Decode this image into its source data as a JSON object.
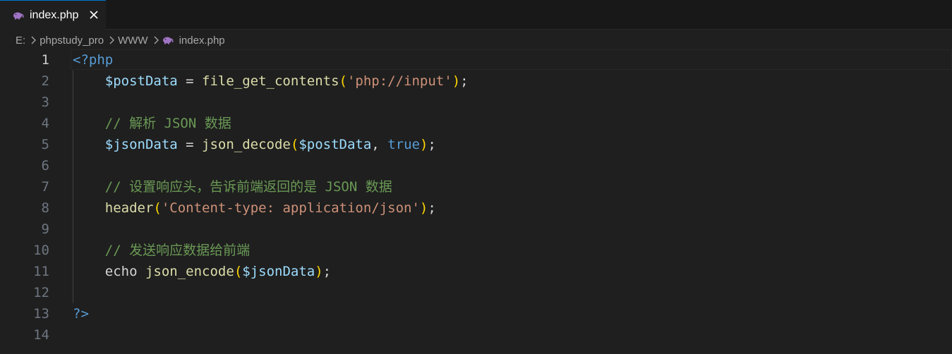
{
  "tab": {
    "label": "index.php",
    "file_icon": "php-elephant-icon",
    "close_icon": "close-icon",
    "accent": "#0078d4",
    "icon_color": "#a074c4"
  },
  "breadcrumb": {
    "items": [
      "E:",
      "phpstudy_pro",
      "WWW",
      "index.php"
    ]
  },
  "editor": {
    "lines": [
      {
        "n": "1",
        "tokens": [
          {
            "c": "tag",
            "t": "<?php"
          }
        ]
      },
      {
        "n": "2",
        "tokens": [
          {
            "c": "plain",
            "t": "    "
          },
          {
            "c": "var",
            "t": "$postData"
          },
          {
            "c": "op",
            "t": " = "
          },
          {
            "c": "fn",
            "t": "file_get_contents"
          },
          {
            "c": "paren",
            "t": "("
          },
          {
            "c": "str",
            "t": "'php://input'"
          },
          {
            "c": "paren",
            "t": ")"
          },
          {
            "c": "punc",
            "t": ";"
          }
        ]
      },
      {
        "n": "3",
        "tokens": []
      },
      {
        "n": "4",
        "tokens": [
          {
            "c": "plain",
            "t": "    "
          },
          {
            "c": "cmt",
            "t": "// 解析 JSON 数据"
          }
        ]
      },
      {
        "n": "5",
        "tokens": [
          {
            "c": "plain",
            "t": "    "
          },
          {
            "c": "var",
            "t": "$jsonData"
          },
          {
            "c": "op",
            "t": " = "
          },
          {
            "c": "fn",
            "t": "json_decode"
          },
          {
            "c": "paren",
            "t": "("
          },
          {
            "c": "var",
            "t": "$postData"
          },
          {
            "c": "punc",
            "t": ", "
          },
          {
            "c": "kw",
            "t": "true"
          },
          {
            "c": "paren",
            "t": ")"
          },
          {
            "c": "punc",
            "t": ";"
          }
        ]
      },
      {
        "n": "6",
        "tokens": []
      },
      {
        "n": "7",
        "tokens": [
          {
            "c": "plain",
            "t": "    "
          },
          {
            "c": "cmt",
            "t": "// 设置响应头，告诉前端返回的是 JSON 数据"
          }
        ]
      },
      {
        "n": "8",
        "tokens": [
          {
            "c": "plain",
            "t": "    "
          },
          {
            "c": "fn",
            "t": "header"
          },
          {
            "c": "paren",
            "t": "("
          },
          {
            "c": "str",
            "t": "'Content-type: application/json'"
          },
          {
            "c": "paren",
            "t": ")"
          },
          {
            "c": "punc",
            "t": ";"
          }
        ]
      },
      {
        "n": "9",
        "tokens": []
      },
      {
        "n": "10",
        "tokens": [
          {
            "c": "plain",
            "t": "    "
          },
          {
            "c": "cmt",
            "t": "// 发送响应数据给前端"
          }
        ]
      },
      {
        "n": "11",
        "tokens": [
          {
            "c": "plain",
            "t": "    "
          },
          {
            "c": "plain",
            "t": "echo "
          },
          {
            "c": "fn",
            "t": "json_encode"
          },
          {
            "c": "paren",
            "t": "("
          },
          {
            "c": "var",
            "t": "$jsonData"
          },
          {
            "c": "paren",
            "t": ")"
          },
          {
            "c": "punc",
            "t": ";"
          }
        ]
      },
      {
        "n": "12",
        "tokens": []
      },
      {
        "n": "13",
        "tokens": [
          {
            "c": "tag",
            "t": "?>"
          }
        ]
      },
      {
        "n": "14",
        "tokens": []
      }
    ],
    "active_line": "1"
  }
}
